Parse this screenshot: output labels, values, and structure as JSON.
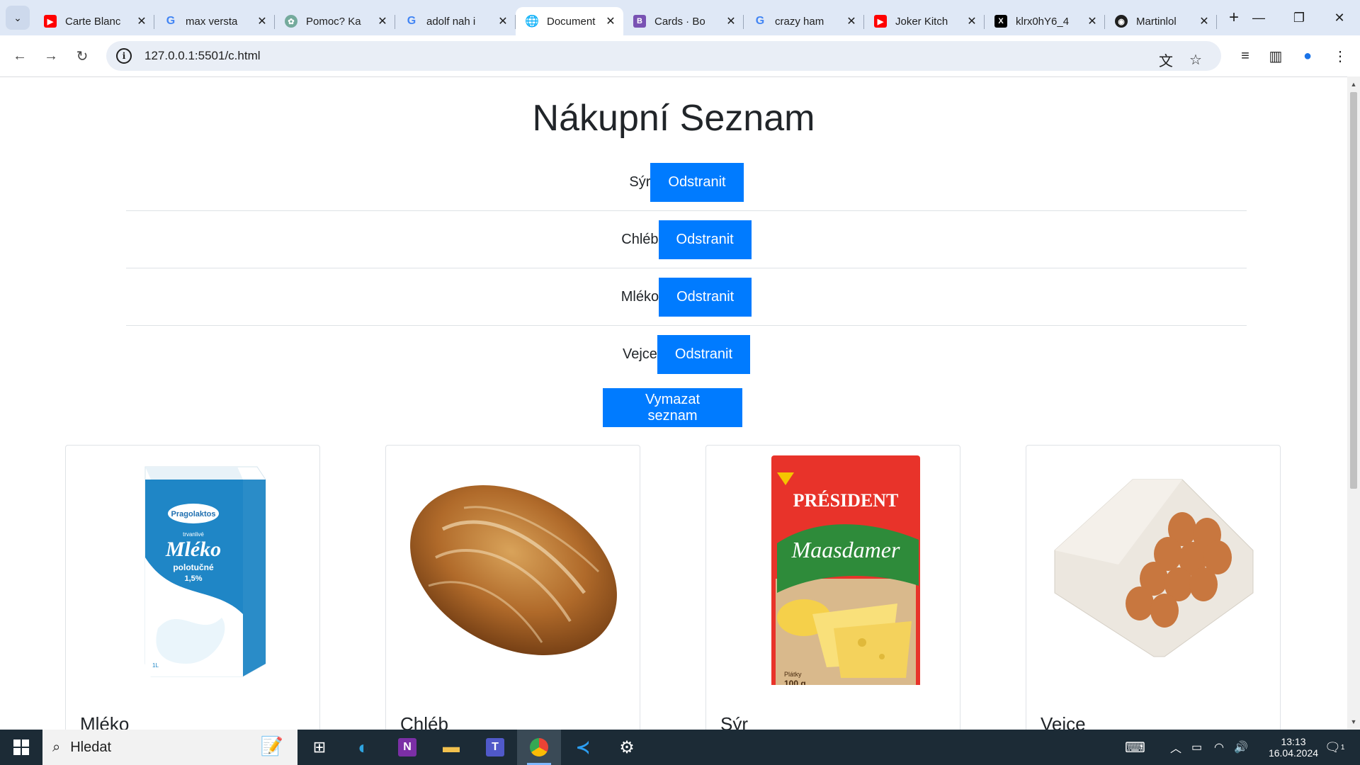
{
  "browser": {
    "tabs": [
      {
        "title": "Carte Blanc",
        "icon": "youtube-icon",
        "color": "#ff0000"
      },
      {
        "title": "max versta",
        "icon": "google-icon",
        "color": "#4285f4"
      },
      {
        "title": "Pomoc? Ka",
        "icon": "chatgpt-icon",
        "color": "#74aa9c"
      },
      {
        "title": "adolf nah i",
        "icon": "google-icon",
        "color": "#4285f4"
      },
      {
        "title": "Document",
        "icon": "globe-icon",
        "color": "#5f6368",
        "active": true
      },
      {
        "title": "Cards · Bo",
        "icon": "bootstrap-icon",
        "color": "#7952b3"
      },
      {
        "title": "crazy ham",
        "icon": "google-icon",
        "color": "#4285f4"
      },
      {
        "title": "Joker Kitch",
        "icon": "youtube-icon",
        "color": "#ff0000"
      },
      {
        "title": "klrx0hY6_4",
        "icon": "x-icon",
        "color": "#000000"
      },
      {
        "title": "Martinlol",
        "icon": "github-icon",
        "color": "#1f1f1f"
      }
    ],
    "url": "127.0.0.1:5501/c.html"
  },
  "page": {
    "title": "Nákupní Seznam",
    "items": [
      {
        "name": "Sýr",
        "button": "Odstranit"
      },
      {
        "name": "Chléb",
        "button": "Odstranit"
      },
      {
        "name": "Mléko",
        "button": "Odstranit"
      },
      {
        "name": "Vejce",
        "button": "Odstranit"
      }
    ],
    "clear_button": "Vymazat seznam",
    "cards": [
      {
        "name": "Mléko",
        "pack_brand": "Pragolaktos",
        "pack_sub": "trvanlivé",
        "pack_title": "Mléko",
        "pack_type": "polotučné",
        "pack_fat": "1,5%",
        "pack_vol": "1L"
      },
      {
        "name": "Chléb"
      },
      {
        "name": "Sýr",
        "pack_brand": "PRÉSIDENT",
        "pack_title": "Maasdamer",
        "pack_tag": "Plátky",
        "pack_weight": "100 g"
      },
      {
        "name": "Vejce"
      }
    ]
  },
  "taskbar": {
    "search_placeholder": "Hledat",
    "time": "13:13",
    "date": "16.04.2024",
    "notifications": "1"
  },
  "colors": {
    "accent": "#007bff",
    "chrome": "#dfe8f6",
    "taskbar": "#1c2b36"
  }
}
